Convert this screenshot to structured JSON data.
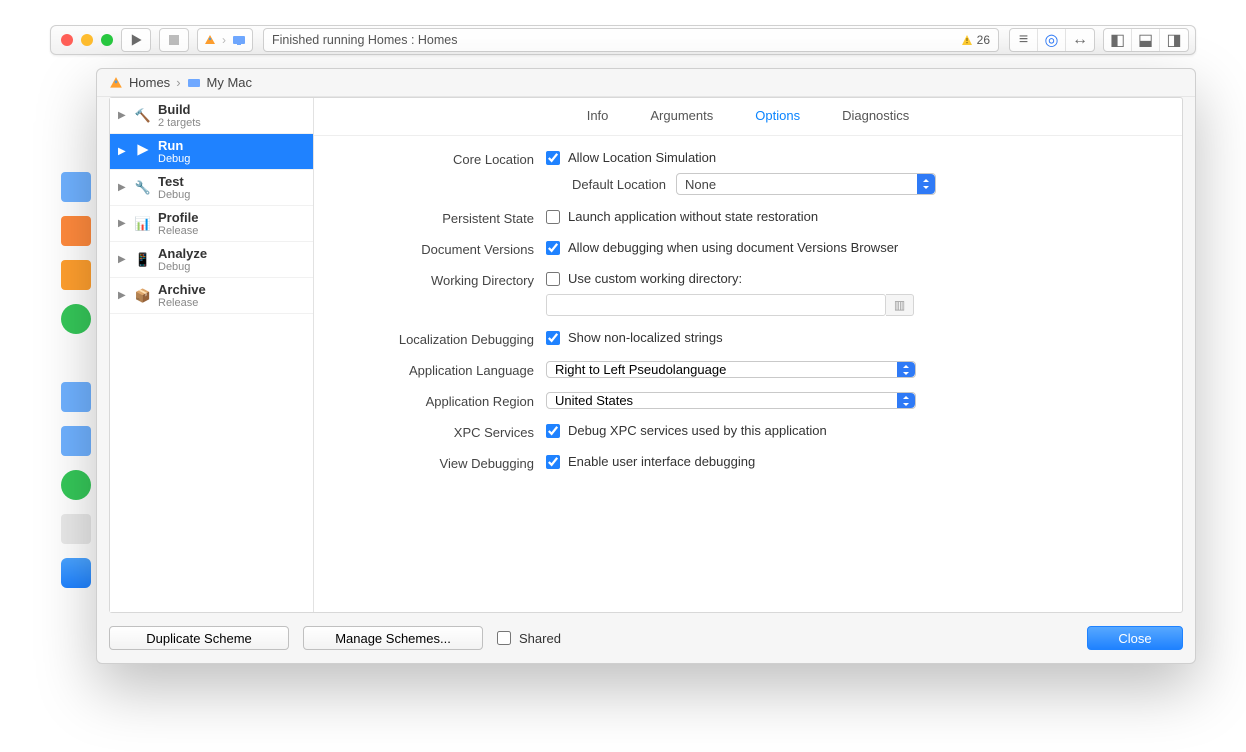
{
  "toolbar": {
    "status": "Finished running Homes : Homes",
    "warning_count": "26"
  },
  "breadcrumb": {
    "project": "Homes",
    "destination": "My Mac"
  },
  "schemes": [
    {
      "title": "Build",
      "sub": "2 targets",
      "icon": "hammer"
    },
    {
      "title": "Run",
      "sub": "Debug",
      "icon": "play"
    },
    {
      "title": "Test",
      "sub": "Debug",
      "icon": "wrench"
    },
    {
      "title": "Profile",
      "sub": "Release",
      "icon": "gauge"
    },
    {
      "title": "Analyze",
      "sub": "Debug",
      "icon": "phone"
    },
    {
      "title": "Archive",
      "sub": "Release",
      "icon": "box"
    }
  ],
  "tabs": {
    "info": "Info",
    "arguments": "Arguments",
    "options": "Options",
    "diagnostics": "Diagnostics"
  },
  "options": {
    "core_location": {
      "label": "Core Location",
      "allow": "Allow Location Simulation",
      "default_label": "Default Location",
      "default_value": "None"
    },
    "persistent_state": {
      "label": "Persistent State",
      "check": "Launch application without state restoration"
    },
    "document_versions": {
      "label": "Document Versions",
      "check": "Allow debugging when using document Versions Browser"
    },
    "working_directory": {
      "label": "Working Directory",
      "check": "Use custom working directory:"
    },
    "localization": {
      "label": "Localization Debugging",
      "check": "Show non-localized strings"
    },
    "app_language": {
      "label": "Application Language",
      "value": "Right to Left Pseudolanguage"
    },
    "app_region": {
      "label": "Application Region",
      "value": "United States"
    },
    "xpc": {
      "label": "XPC Services",
      "check": "Debug XPC services used by this application"
    },
    "view_debug": {
      "label": "View Debugging",
      "check": "Enable user interface debugging"
    }
  },
  "footer": {
    "duplicate": "Duplicate Scheme",
    "manage": "Manage Schemes...",
    "shared": "Shared",
    "close": "Close"
  }
}
